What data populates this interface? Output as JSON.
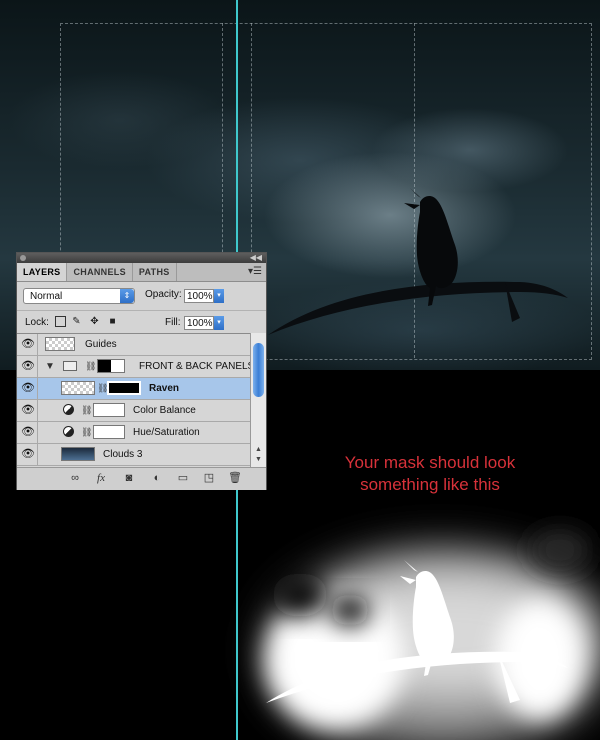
{
  "panel": {
    "tabs": [
      "LAYERS",
      "CHANNELS",
      "PATHS"
    ],
    "blend_mode": "Normal",
    "opacity_label": "Opacity:",
    "opacity_value": "100%",
    "lock_label": "Lock:",
    "fill_label": "Fill:",
    "fill_value": "100%",
    "layers": [
      {
        "name": "Guides"
      },
      {
        "name": "FRONT & BACK PANELS"
      },
      {
        "name": "Raven"
      },
      {
        "name": "Color Balance"
      },
      {
        "name": "Hue/Saturation"
      },
      {
        "name": "Clouds 3"
      }
    ],
    "icons": [
      "eye-icon",
      "lock-transparent-icon",
      "brush-icon",
      "move-icon",
      "padlock-icon",
      "link-icon",
      "fx-icon",
      "mask-icon",
      "adjustment-icon",
      "folder-icon",
      "new-layer-icon",
      "trash-icon"
    ]
  },
  "caption": {
    "line1": "Your mask should look",
    "line2": "something like this"
  },
  "colors": {
    "guide": "#3fc8cc",
    "caption": "#d8323a",
    "selected_layer": "#a7c6ea"
  }
}
